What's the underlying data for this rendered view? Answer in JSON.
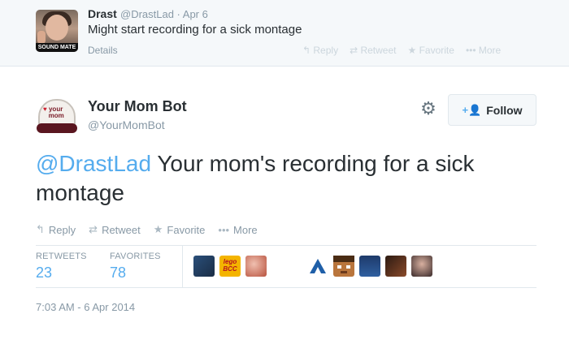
{
  "parent_tweet": {
    "author_name": "Drast",
    "handle_date": "@DrastLad · Apr 6",
    "text": "Might start recording for a sick montage",
    "avatar_caption": "SOUND MATE",
    "details_label": "Details",
    "actions": [
      "Reply",
      "Retweet",
      "Favorite",
      "More"
    ]
  },
  "tweet": {
    "author_name": "Your Mom Bot",
    "handle": "@YourMomBot",
    "avatar_text_line1": "your",
    "avatar_text_line2": "mom",
    "follow_label": "Follow",
    "mention": "@DrastLad",
    "body": " Your mom's recording for a sick montage",
    "actions": [
      "Reply",
      "Retweet",
      "Favorite",
      "More"
    ],
    "stats": {
      "retweets_label": "RETWEETS",
      "retweets": "23",
      "favorites_label": "FAVORITES",
      "favorites": "78"
    },
    "favoriter_avatar_text": [
      "lego",
      "BCC"
    ],
    "timestamp": "7:03 AM - 6 Apr 2014"
  },
  "icons": {
    "gear": "gear-icon",
    "follow": "add-user-icon",
    "reply": "reply-icon",
    "retweet": "retweet-icon",
    "favorite": "star-icon",
    "more": "more-dots-icon"
  },
  "colors": {
    "accent": "#55acee",
    "muted": "#8899a6",
    "text": "#292f33"
  }
}
